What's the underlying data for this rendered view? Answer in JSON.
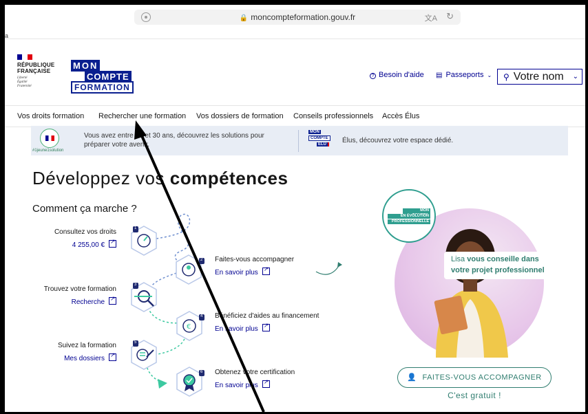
{
  "browser": {
    "url": "moncompteformation.gouv.fr",
    "side_letter": "a"
  },
  "header": {
    "rf_title_line1": "RÉPUBLIQUE",
    "rf_title_line2": "FRANÇAISE",
    "rf_motto_line1": "Liberté",
    "rf_motto_line2": "Égalité",
    "rf_motto_line3": "Fraternité",
    "mcf_line1": "MON",
    "mcf_line2": "COMPTE",
    "mcf_line3": "FORMATION",
    "help_label": "Besoin d'aide",
    "passports_label": "Passeports",
    "account_label": "Votre nom"
  },
  "nav": {
    "items": [
      "Vos droits formation",
      "Rechercher une formation",
      "Vos dossiers de formation",
      "Conseils professionnels",
      "Accès Élus"
    ]
  },
  "banner": {
    "hashtag": "#1jeune1solution",
    "youth_text": "Vous avez entre 16 et 30 ans, découvrez les solutions pour préparer votre avenir.",
    "mini_logo_1": "MON",
    "mini_logo_2": "COMPTE",
    "mini_logo_3": "ELU",
    "elus_text": "Élus, découvrez votre espace dédié."
  },
  "hero": {
    "title_regular": "Développez vos ",
    "title_bold": "compétences",
    "how_title": "Comment ça marche ?"
  },
  "steps": {
    "s1_title": "Consultez vos droits",
    "s1_link": "4 255,00 €",
    "s2_title": "Faites-vous accompagner",
    "s2_link": "En savoir plus",
    "s3_title": "Trouvez votre formation",
    "s3_link": "Recherche",
    "s4_title": "Bénéficiez d'aides au financement",
    "s4_link": "En savoir plus",
    "s5_title": "Suivez la formation",
    "s5_link": "Mes dossiers",
    "s6_title": "Obtenez votre certification",
    "s6_link": "En savoir plus",
    "numbers": [
      "1",
      "2",
      "3",
      "4",
      "5",
      "6"
    ]
  },
  "promo": {
    "badge_line1": "MON CONSEIL",
    "badge_line2": "EN ÉVOLUTION",
    "badge_line3": "PROFESSIONNELLE",
    "lisa_regular": "Lisa ",
    "lisa_bold": "vous conseille dans votre projet professionnel",
    "button_label": "FAITES-VOUS ACCOMPAGNER",
    "free_text": "C'est gratuit !"
  },
  "colors": {
    "primary_blue": "#000091",
    "teal": "#2f7d6f",
    "banner_bg": "#e8edf5"
  }
}
